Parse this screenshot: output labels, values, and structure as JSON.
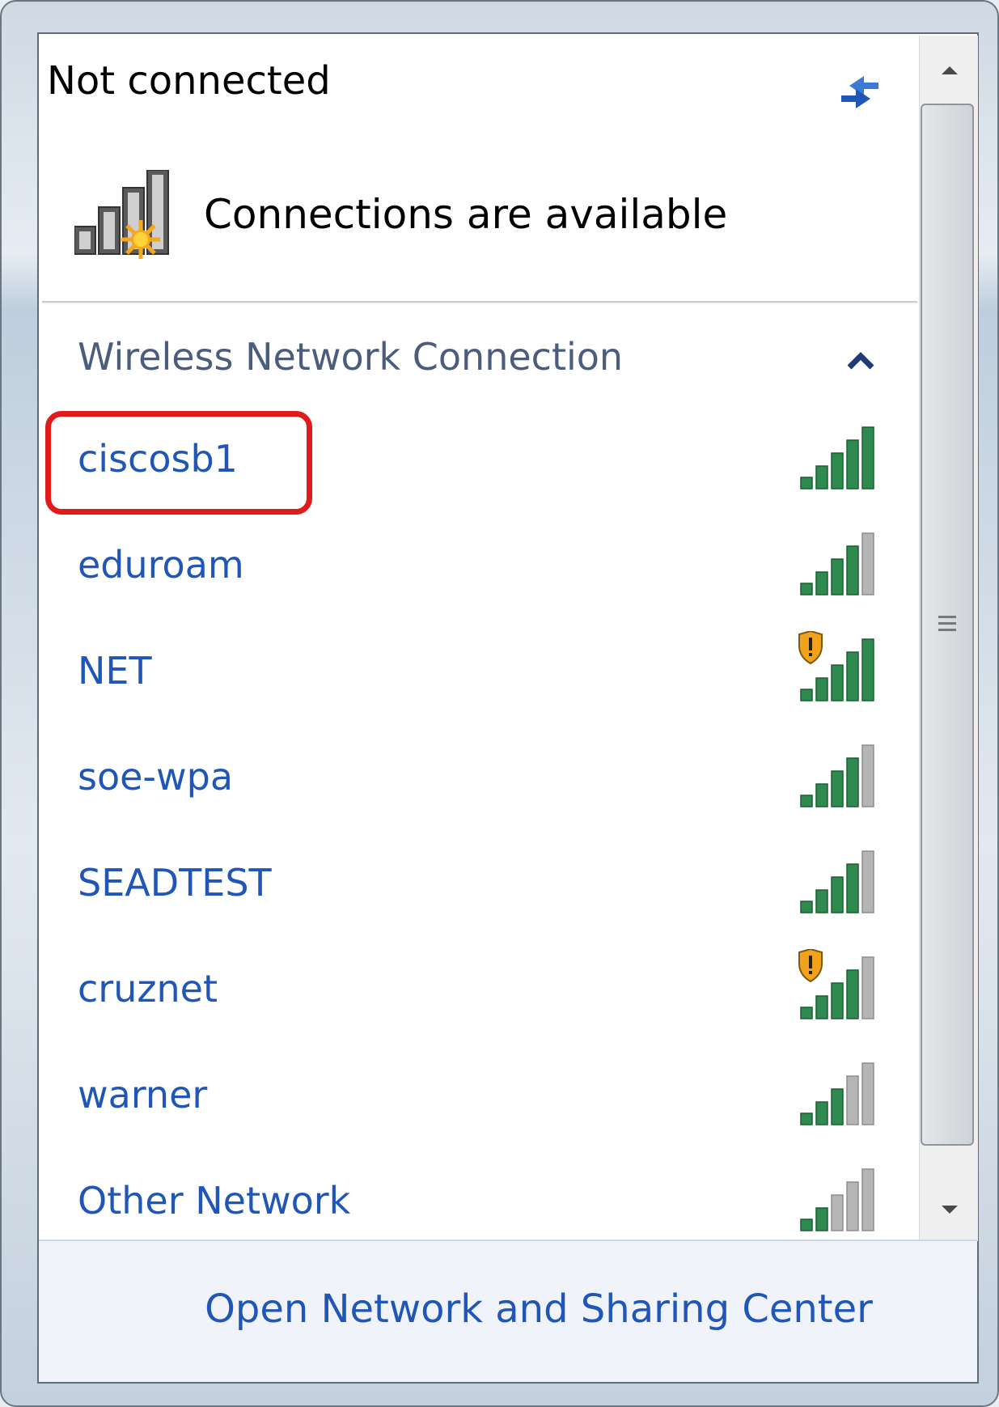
{
  "header": {
    "status": "Not connected",
    "availability": "Connections are available"
  },
  "section": {
    "title": "Wireless Network Connection"
  },
  "networks": [
    {
      "name": "ciscosb1",
      "bars": 5,
      "secured_warning": false,
      "highlighted": true
    },
    {
      "name": "eduroam",
      "bars": 4,
      "secured_warning": false,
      "highlighted": false
    },
    {
      "name": "NET",
      "bars": 5,
      "secured_warning": true,
      "highlighted": false
    },
    {
      "name": "soe-wpa",
      "bars": 4,
      "secured_warning": false,
      "highlighted": false
    },
    {
      "name": "SEADTEST",
      "bars": 4,
      "secured_warning": false,
      "highlighted": false
    },
    {
      "name": "cruznet",
      "bars": 4,
      "secured_warning": true,
      "highlighted": false
    },
    {
      "name": "warner",
      "bars": 3,
      "secured_warning": false,
      "highlighted": false
    },
    {
      "name": "Other Network",
      "bars": 2,
      "secured_warning": false,
      "highlighted": false
    }
  ],
  "footer": {
    "link": "Open Network and Sharing Center"
  },
  "colors": {
    "link": "#1f56b8",
    "signal_on": "#2e8a4e",
    "signal_off": "#b5b5b5",
    "highlight": "#e11a1a"
  }
}
